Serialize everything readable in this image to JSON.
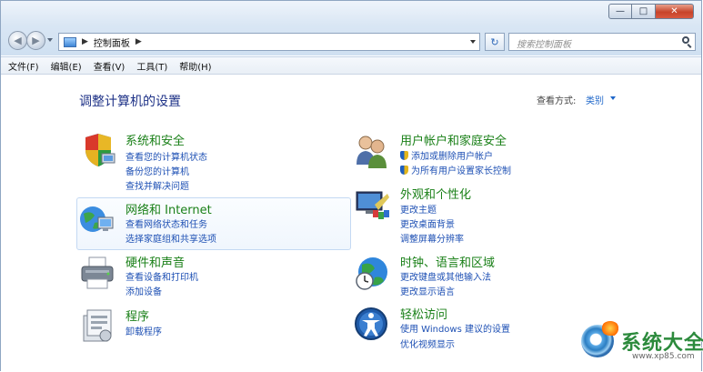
{
  "window": {
    "caption_buttons": {
      "minimize": "—",
      "maximize": "□",
      "close": "✕"
    }
  },
  "navigation": {
    "back_glyph": "◀",
    "forward_glyph": "▶",
    "address_separator": "▶",
    "address_path": "控制面板",
    "address_separator_end": "▶",
    "refresh_glyph": "↻",
    "search_placeholder": "搜索控制面板"
  },
  "menubar": {
    "items": [
      "文件(F)",
      "编辑(E)",
      "查看(V)",
      "工具(T)",
      "帮助(H)"
    ]
  },
  "content": {
    "heading": "调整计算机的设置",
    "view_by_label": "查看方式:",
    "view_by_value": "类别",
    "categories": [
      {
        "title": "系统和安全",
        "icon": "shield-monitor-icon",
        "links": [
          "查看您的计算机状态",
          "备份您的计算机",
          "查找并解决问题"
        ]
      },
      {
        "title": "网络和 Internet",
        "icon": "network-globe-icon",
        "links": [
          "查看网络状态和任务",
          "选择家庭组和共享选项"
        ]
      },
      {
        "title": "硬件和声音",
        "icon": "printer-icon",
        "links": [
          "查看设备和打印机",
          "添加设备"
        ]
      },
      {
        "title": "程序",
        "icon": "programs-icon",
        "links": [
          "卸载程序"
        ]
      },
      {
        "title": "用户帐户和家庭安全",
        "icon": "users-icon",
        "links": [
          "添加或删除用户帐户",
          "为所有用户设置家长控制"
        ]
      },
      {
        "title": "外观和个性化",
        "icon": "appearance-icon",
        "links": [
          "更改主题",
          "更改桌面背景",
          "调整屏幕分辨率"
        ]
      },
      {
        "title": "时钟、语言和区域",
        "icon": "clock-globe-icon",
        "links": [
          "更改键盘或其他输入法",
          "更改显示语言"
        ]
      },
      {
        "title": "轻松访问",
        "icon": "ease-of-access-icon",
        "links": [
          "使用 Windows 建议的设置",
          "优化视频显示"
        ]
      }
    ]
  },
  "watermark": {
    "text": "系统大全",
    "url": "www.xp85.com"
  },
  "colors": {
    "category_title": "#1a8018",
    "link": "#1e50b4",
    "heading": "#1e3287"
  }
}
